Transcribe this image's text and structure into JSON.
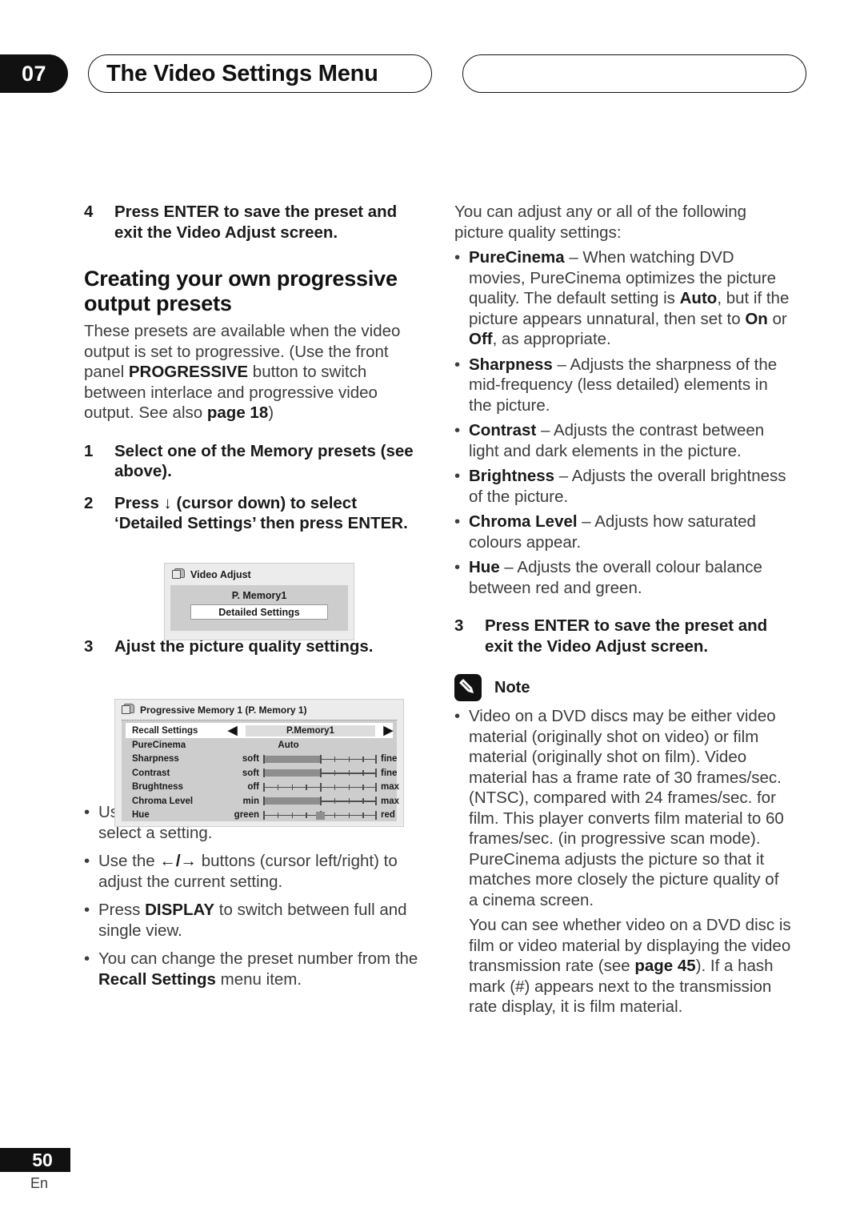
{
  "header": {
    "chapter_number": "07",
    "chapter_title": "The Video Settings Menu"
  },
  "left_column": {
    "step4": {
      "num": "4",
      "text_html": "Press ENTER to save the preset and exit the Video Adjust screen."
    },
    "heading": "Creating your own progressive output presets",
    "intro_html": "These presets are available when the video output is set to progressive. (Use the front panel <b>PROGRESSIVE</b> button to switch between interlace and progressive video output. See also <b>page 18</b>)",
    "step1": {
      "num": "1",
      "text_html": "Select one of the Memory presets (see above)."
    },
    "step2": {
      "num": "2",
      "text_html": "Press ↓ (cursor down) to select ‘Detailed Settings’ then press ENTER."
    },
    "step3": {
      "num": "3",
      "text_html": "Ajust the picture quality settings."
    },
    "bullets": [
      {
        "text_html": "Use the <b>↑/↓</b> buttons (cursor up/down) to select a setting."
      },
      {
        "text_html": "Use the <b>←/→</b> buttons (cursor left/right) to adjust the current setting."
      },
      {
        "text_html": "Press <b>DISPLAY</b> to switch between full and single view."
      },
      {
        "text_html": "You can change the preset number from the <b>Recall Settings</b> menu item."
      }
    ]
  },
  "osd_video_adjust": {
    "title": "Video Adjust",
    "memory_label": "P. Memory1",
    "button_label": "Detailed Settings"
  },
  "osd_progressive_memory": {
    "title": "Progressive Memory 1 (P. Memory 1)",
    "rows": [
      {
        "label": "Recall Settings",
        "type": "select",
        "value": "P.Memory1",
        "left_arrow": "◀",
        "right_arrow": "▶",
        "highlight": true
      },
      {
        "label": "PureCinema",
        "type": "text",
        "value": "Auto",
        "highlight": false
      },
      {
        "label": "Sharpness",
        "type": "slider",
        "min_label": "soft",
        "max_label": "fine",
        "fill": 0.5,
        "knob": null,
        "highlight": false
      },
      {
        "label": "Contrast",
        "type": "slider",
        "min_label": "soft",
        "max_label": "fine",
        "fill": 0.5,
        "knob": null,
        "highlight": false
      },
      {
        "label": "Brughtness",
        "type": "slider",
        "min_label": "off",
        "max_label": "max",
        "fill": 0,
        "knob": null,
        "highlight": false
      },
      {
        "label": "Chroma Level",
        "type": "slider",
        "min_label": "min",
        "max_label": "max",
        "fill": 0.5,
        "knob": null,
        "highlight": false
      },
      {
        "label": "Hue",
        "type": "slider",
        "min_label": "green",
        "max_label": "red",
        "fill": 0,
        "knob": 0.5,
        "highlight": false
      }
    ]
  },
  "right_column": {
    "intro": "You can adjust any or all of the following picture quality settings:",
    "bullets": [
      {
        "text_html": "<b>PureCinema</b> – When watching DVD movies, PureCinema optimizes the picture quality. The default setting is <b>Auto</b>, but if the picture appears unnatural, then set to <b>On</b> or <b>Off</b>, as appropriate."
      },
      {
        "text_html": "<b>Sharpness</b> – Adjusts the sharpness of the mid-frequency (less detailed) elements in the picture."
      },
      {
        "text_html": "<b>Contrast</b> – Adjusts the contrast between light and dark elements in the picture."
      },
      {
        "text_html": "<b>Brightness</b> – Adjusts the overall brightness of the picture."
      },
      {
        "text_html": "<b>Chroma Level</b> – Adjusts how saturated colours appear."
      },
      {
        "text_html": "<b>Hue</b> – Adjusts the overall colour balance between red and green."
      }
    ],
    "step3": {
      "num": "3",
      "text_html": "Press ENTER to save the preset and exit the Video Adjust screen."
    },
    "note_label": "Note",
    "note_bullet_html": "Video on a DVD discs may be either video material (originally shot on video) or film material (originally shot on film). Video material has a frame rate of 30 frames/sec.(NTSC), compared with 24 frames/sec. for film. This player converts film material to 60 frames/sec. (in progressive scan mode). PureCinema adjusts the picture so that it matches more closely the picture quality of a cinema screen.",
    "note_para_html": "You can see whether video on a DVD disc is film or video material by displaying the video transmission rate (see <b>page 45</b>). If a hash mark (#) appears next to the transmission rate display, it is film material."
  },
  "footer": {
    "page_number": "50",
    "language": "En"
  }
}
